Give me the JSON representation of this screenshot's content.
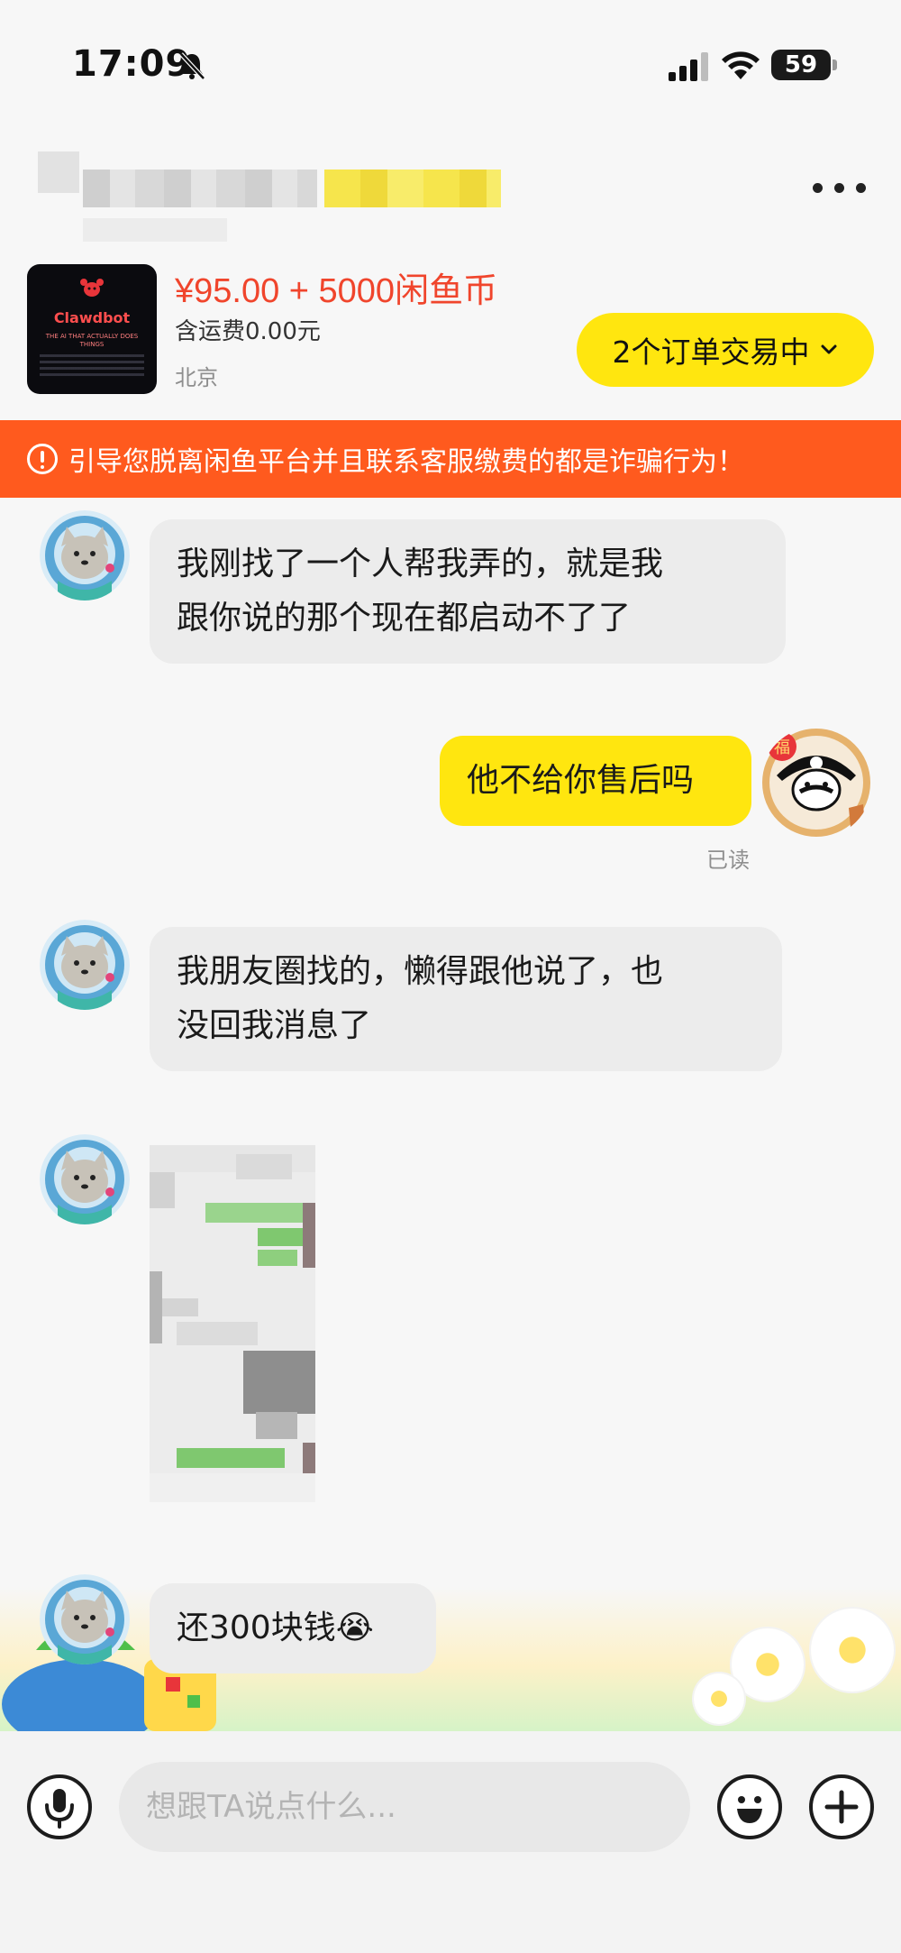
{
  "status_bar": {
    "time": "17:09",
    "battery": "59"
  },
  "product": {
    "price": "¥95.00 + 5000闲鱼币",
    "shipping": "含运费0.00元",
    "location": "北京",
    "order_button_label": "2个订单交易中",
    "thumbnail": {
      "name": "Clawdbot",
      "tagline": "THE AI THAT ACTUALLY DOES THINGS"
    }
  },
  "warning": {
    "text": "引导您脱离闲鱼平台并且联系客服缴费的都是诈骗行为！"
  },
  "messages": [
    {
      "from": "other",
      "lines": [
        "我刚找了一个人帮我弄的，就是我",
        "跟你说的那个现在都启动不了了"
      ]
    },
    {
      "from": "self",
      "lines": [
        "他不给你售后吗"
      ],
      "status": "已读"
    },
    {
      "from": "other",
      "lines": [
        "我朋友圈找的，懒得跟他说了，也",
        "没回我消息了"
      ]
    },
    {
      "from": "other",
      "type": "image"
    },
    {
      "from": "other",
      "lines": [
        "还300块钱😭"
      ]
    }
  ],
  "composer": {
    "placeholder": "想跟TA说点什么..."
  },
  "colors": {
    "accent_yellow": "#ffe60f",
    "warning_orange": "#ff5a1e",
    "price_red": "#f0452c"
  },
  "icons": [
    "bell-slash-icon",
    "signal-icon",
    "wifi-icon",
    "more-icon",
    "chevron-down-icon",
    "warning-icon",
    "microphone-icon",
    "emoji-icon",
    "plus-icon"
  ]
}
